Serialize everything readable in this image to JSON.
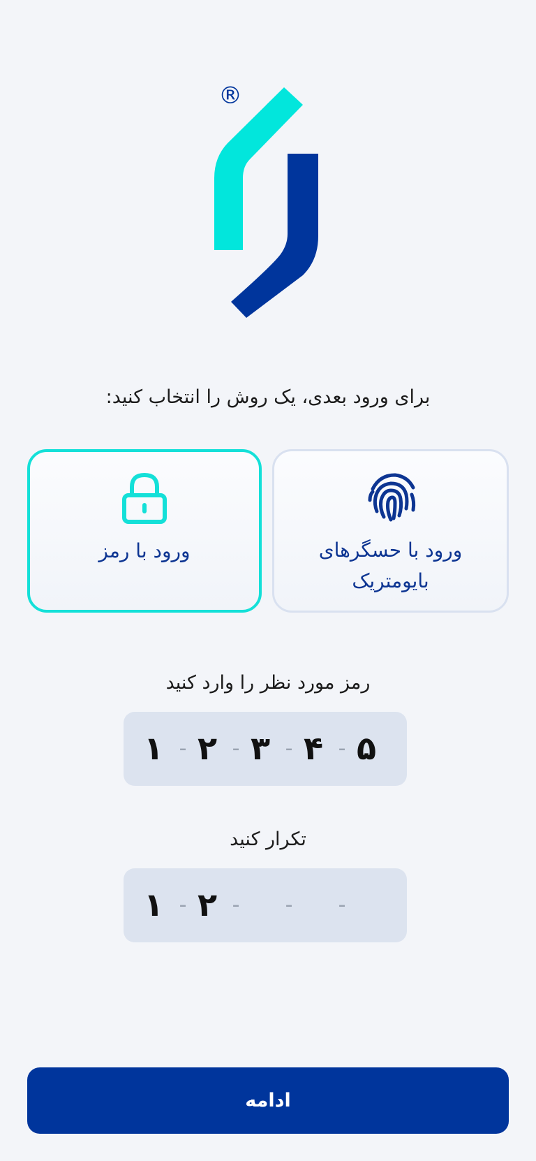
{
  "brand": {
    "registered_mark": "®",
    "color_primary": "#00359c",
    "color_accent": "#14e0d8"
  },
  "prompt": "برای ورود بعدی، یک روش را انتخاب کنید:",
  "methods": {
    "biometric": {
      "icon": "fingerprint-icon",
      "label_line1": "ورود با حسگرهای",
      "label_line2": "بایومتریک",
      "selected": false
    },
    "password": {
      "icon": "lock-icon",
      "label": "ورود با رمز",
      "selected": true
    }
  },
  "pin": {
    "label": "رمز مورد نظر را وارد کنید",
    "separator": "-",
    "digits": [
      "۱",
      "۲",
      "۳",
      "۴",
      "۵"
    ]
  },
  "confirm": {
    "label": "تکرار کنید",
    "separator": "-",
    "digits": [
      "۱",
      "۲",
      "",
      "",
      ""
    ]
  },
  "continue_button": "ادامه"
}
